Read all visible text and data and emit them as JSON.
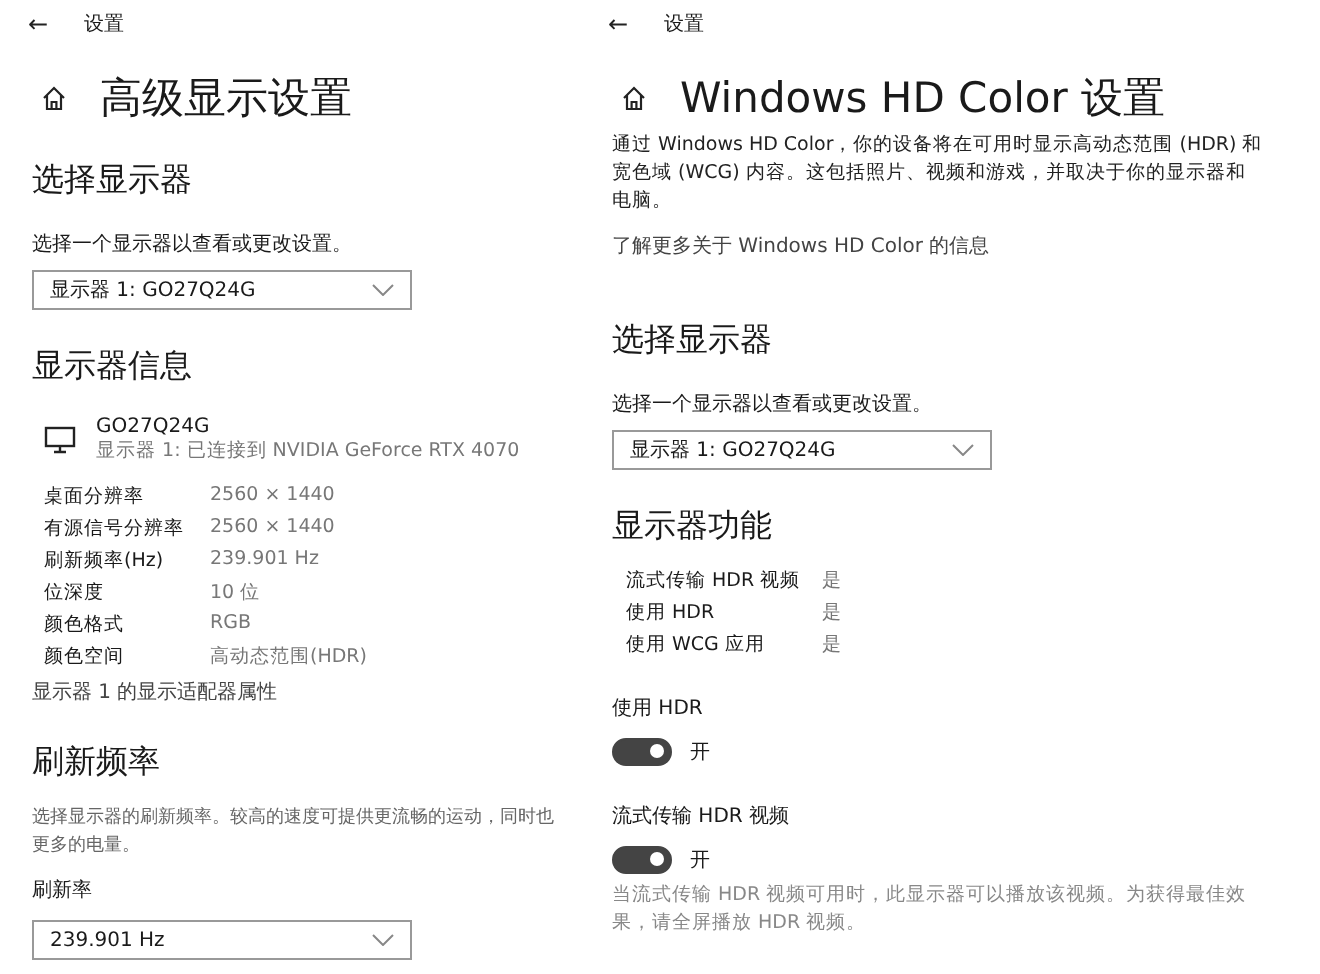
{
  "panels": [
    {
      "nav": {
        "back": "←",
        "title": "设置"
      },
      "title": "高级显示设置",
      "blocks": [
        {
          "kind": "heading",
          "text": "选择显示器"
        },
        {
          "kind": "label",
          "text": "选择一个显示器以查看或更改设置。"
        },
        {
          "kind": "dropdown",
          "value": "显示器 1: GO27Q24G"
        },
        {
          "kind": "heading",
          "text": "显示器信息"
        },
        {
          "kind": "monitor",
          "name": "GO27Q24G",
          "detail": "显示器 1: 已连接到 NVIDIA GeForce RTX 4070"
        },
        {
          "kind": "info",
          "rows": [
            {
              "label": "桌面分辨率",
              "value": "2560 × 1440"
            },
            {
              "label": "有源信号分辨率",
              "value": "2560 × 1440"
            },
            {
              "label": "刷新频率(Hz)",
              "value": "239.901 Hz"
            },
            {
              "label": "位深度",
              "value": "10 位"
            },
            {
              "label": "颜色格式",
              "value": "RGB"
            },
            {
              "label": "颜色空间",
              "value": "高动态范围(HDR)"
            }
          ]
        },
        {
          "kind": "link",
          "text": "显示器 1 的显示适配器属性"
        },
        {
          "kind": "heading",
          "text": "刷新频率"
        },
        {
          "kind": "paragraph",
          "lines": [
            "选择显示器的刷新频率。较高的速度可提供更流畅的运动，同时也",
            "更多的电量。"
          ]
        },
        {
          "kind": "label",
          "text": "刷新率"
        },
        {
          "kind": "dropdown",
          "value": "239.901 Hz"
        }
      ]
    },
    {
      "nav": {
        "back": "←",
        "title": "设置"
      },
      "title": "Windows HD Color 设置",
      "blocks": [
        {
          "kind": "paragraph",
          "lines": [
            "通过 Windows HD Color，你的设备将在可用时显示高动态范围 (HDR) 和",
            "宽色域 (WCG) 内容。这包括照片、视频和游戏，并取决于你的显示器和",
            "电脑。"
          ]
        },
        {
          "kind": "link",
          "text": "了解更多关于 Windows HD Color 的信息"
        },
        {
          "kind": "heading",
          "text": "选择显示器"
        },
        {
          "kind": "label",
          "text": "选择一个显示器以查看或更改设置。"
        },
        {
          "kind": "dropdown",
          "value": "显示器 1: GO27Q24G"
        },
        {
          "kind": "heading",
          "text": "显示器功能"
        },
        {
          "kind": "info",
          "rows": [
            {
              "label": "流式传输 HDR 视频",
              "value": "是"
            },
            {
              "label": "使用 HDR",
              "value": "是"
            },
            {
              "label": "使用 WCG 应用",
              "value": "是"
            }
          ]
        },
        {
          "kind": "toggle",
          "label": "使用 HDR",
          "on": true,
          "state": "开"
        },
        {
          "kind": "toggle",
          "label": "流式传输 HDR 视频",
          "on": true,
          "state": "开"
        },
        {
          "kind": "paragraph",
          "lines": [
            "当流式传输 HDR 视频可用时，此显示器可以播放该视频。为获得最佳效",
            "果，请全屏播放 HDR 视频。"
          ]
        }
      ]
    }
  ]
}
